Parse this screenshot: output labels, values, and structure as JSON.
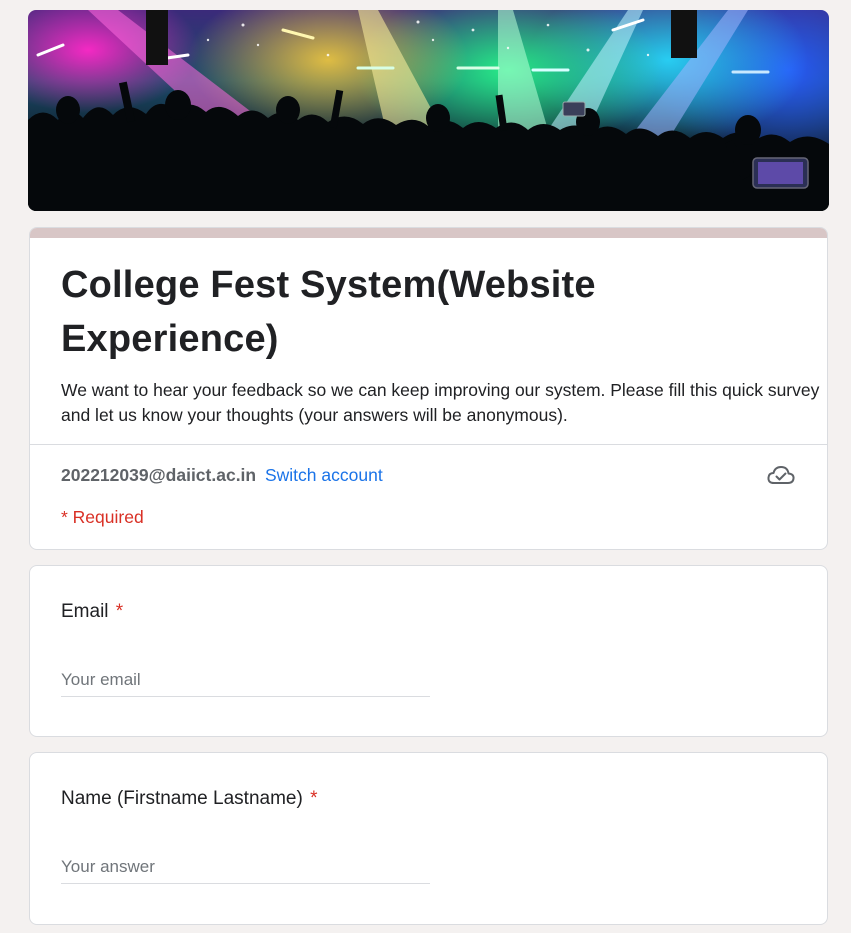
{
  "banner": {
    "description_icon": "concert-crowd-image"
  },
  "form": {
    "title": "College Fest System(Website Experience)",
    "description": "We want to hear your feedback so we can keep improving our system. Please fill this quick survey and let us know your thoughts (your answers will be anonymous).",
    "account_email": "202212039@daiict.ac.in",
    "switch_account_label": "Switch account",
    "cloud_icon": "cloud-saved-icon",
    "required_note": "* Required"
  },
  "questions": [
    {
      "label": "Email",
      "required_mark": "*",
      "placeholder": "Your email"
    },
    {
      "label": "Name (Firstname Lastname)",
      "required_mark": "*",
      "placeholder": "Your answer"
    }
  ],
  "colors": {
    "accent": "#1a73e8",
    "required": "#d93025",
    "title_bar": "#d8c6c6",
    "background": "#f4f1f0"
  }
}
